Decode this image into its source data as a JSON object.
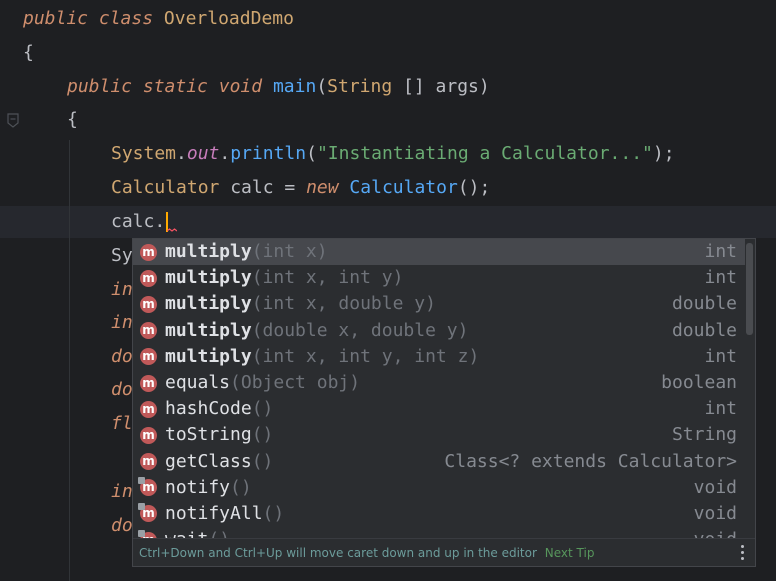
{
  "code": {
    "line1": {
      "kw1": "public",
      "kw2": "class",
      "name": "OverloadDemo"
    },
    "line2": "{",
    "line3": {
      "kw1": "public",
      "kw2": "static",
      "kw3": "void",
      "fn": "main",
      "open": "(",
      "type": "String",
      "arr": " [] ",
      "arg": "args",
      "close": ")"
    },
    "line4": "{",
    "line5": {
      "cls": "System",
      "dot1": ".",
      "field": "out",
      "dot2": ".",
      "method": "println",
      "open": "(",
      "str": "\"Instantiating a Calculator...\"",
      "close": ");"
    },
    "line6": {
      "cls": "Calculator",
      "var": " calc = ",
      "kw": "new",
      "ctor": " Calculator",
      "end": "();"
    },
    "line7": "calc.",
    "hidden_lines": [
      {
        "frag": "Sy",
        "style": "plain"
      },
      {
        "frag": "in",
        "style": "kw"
      },
      {
        "frag": "in",
        "style": "kw"
      },
      {
        "frag": "do",
        "style": "kw"
      },
      {
        "frag": "do",
        "style": "kw"
      },
      {
        "frag": "fl",
        "style": "kw"
      },
      {
        "frag": "in",
        "style": "kw"
      },
      {
        "frag": "do",
        "style": "kw"
      }
    ]
  },
  "completion": {
    "items": [
      {
        "name": "multiply",
        "params": "(int x)",
        "ret": "int",
        "bold": true,
        "selected": true,
        "inherited": false
      },
      {
        "name": "multiply",
        "params": "(int x, int y)",
        "ret": "int",
        "bold": true,
        "selected": false,
        "inherited": false
      },
      {
        "name": "multiply",
        "params": "(int x, double y)",
        "ret": "double",
        "bold": true,
        "selected": false,
        "inherited": false
      },
      {
        "name": "multiply",
        "params": "(double x, double y)",
        "ret": "double",
        "bold": true,
        "selected": false,
        "inherited": false
      },
      {
        "name": "multiply",
        "params": "(int x, int y, int z)",
        "ret": "int",
        "bold": true,
        "selected": false,
        "inherited": false
      },
      {
        "name": "equals",
        "params": "(Object obj)",
        "ret": "boolean",
        "bold": false,
        "selected": false,
        "inherited": false
      },
      {
        "name": "hashCode",
        "params": "()",
        "ret": "int",
        "bold": false,
        "selected": false,
        "inherited": false
      },
      {
        "name": "toString",
        "params": "()",
        "ret": "String",
        "bold": false,
        "selected": false,
        "inherited": false
      },
      {
        "name": "getClass",
        "params": "()",
        "ret": "Class<? extends Calculator>",
        "bold": false,
        "selected": false,
        "inherited": false
      },
      {
        "name": "notify",
        "params": "()",
        "ret": "void",
        "bold": false,
        "selected": false,
        "inherited": true
      },
      {
        "name": "notifyAll",
        "params": "()",
        "ret": "void",
        "bold": false,
        "selected": false,
        "inherited": true
      },
      {
        "name": "wait",
        "params": "()",
        "ret": "void",
        "bold": false,
        "selected": false,
        "inherited": true
      }
    ],
    "method_icon_letter": "m",
    "footer_hint": "Ctrl+Down and Ctrl+Up will move caret down and up in the editor",
    "footer_link": "Next Tip"
  },
  "colors": {
    "accent_method_icon": "#c05959",
    "selected_row": "#46484d",
    "popup_bg": "#2b2d30",
    "editor_bg": "#1e1f22"
  }
}
